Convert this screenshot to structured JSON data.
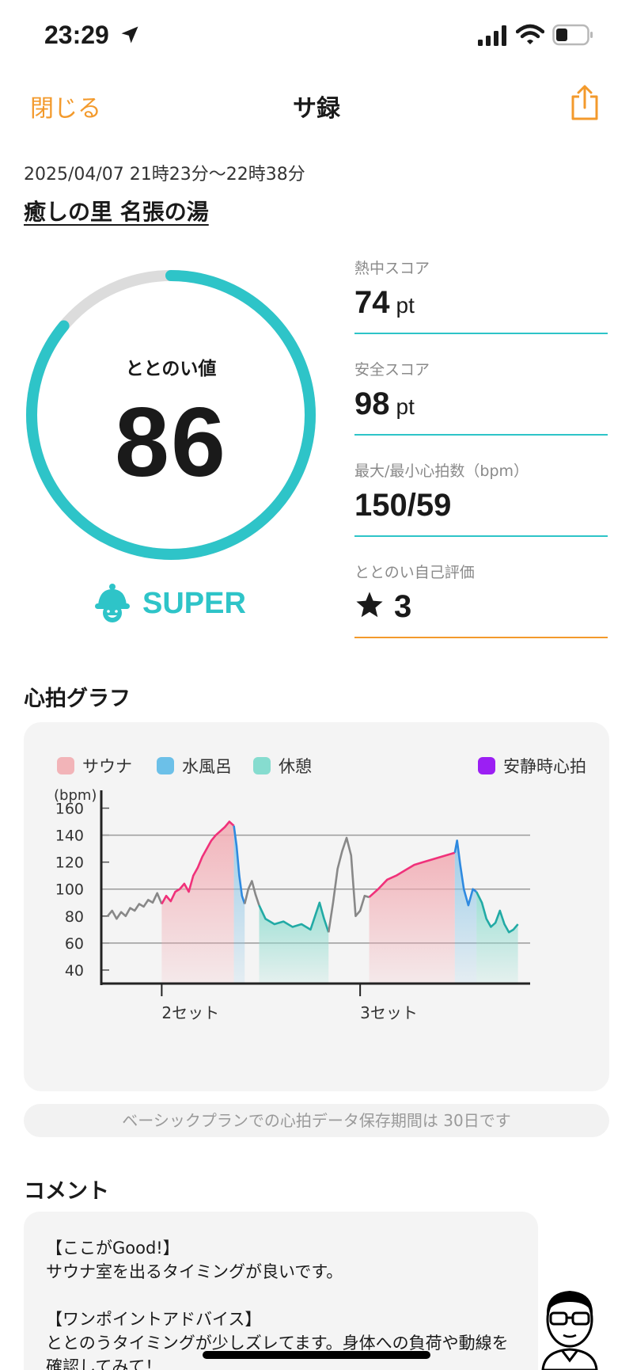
{
  "status": {
    "time": "23:29"
  },
  "nav": {
    "close_label": "閉じる",
    "title": "サ録"
  },
  "session": {
    "datetime": "2025/04/07 21時23分〜22時38分",
    "place": "癒しの里 名張の湯"
  },
  "gauge": {
    "label": "ととのい値",
    "value": "86",
    "fill_fraction": 0.86,
    "rank": "SUPER"
  },
  "scores": [
    {
      "label": "熱中スコア",
      "value": "74",
      "unit": "pt"
    },
    {
      "label": "安全スコア",
      "value": "98",
      "unit": "pt"
    },
    {
      "label": "最大/最小心拍数（bpm）",
      "value": "150/59",
      "unit": ""
    },
    {
      "label": "ととのい自己評価",
      "value": "3",
      "unit": ""
    }
  ],
  "colors": {
    "accent": "#2ec4c8",
    "orange": "#f39a2c",
    "sauna": "#f0317a",
    "water": "#2f8ae0",
    "rest": "#22aaa5",
    "resting_hr": "#9b1ff3"
  },
  "chart_section_title": "心拍グラフ",
  "legend": {
    "sauna": "サウナ",
    "water": "水風呂",
    "rest": "休憩",
    "resting_hr": "安静時心拍"
  },
  "chart_data": {
    "type": "line",
    "ylabel": "(bpm)",
    "ylim": [
      30,
      165
    ],
    "yticks": [
      "160",
      "140",
      "120",
      "100",
      "80",
      "60",
      "40"
    ],
    "x_markers": [
      {
        "x": 12,
        "label": "2セット"
      },
      {
        "x": 56,
        "label": "3セット"
      }
    ],
    "xlim": [
      0,
      93
    ],
    "segments": [
      {
        "phase": "other",
        "points": [
          [
            0,
            80
          ],
          [
            1,
            84
          ],
          [
            2,
            78
          ],
          [
            3,
            83
          ],
          [
            4,
            80
          ],
          [
            5,
            86
          ],
          [
            6,
            84
          ],
          [
            7,
            89
          ],
          [
            8,
            87
          ],
          [
            9,
            92
          ],
          [
            10,
            90
          ],
          [
            11,
            97
          ],
          [
            12,
            89
          ]
        ]
      },
      {
        "phase": "sauna",
        "points": [
          [
            12,
            89
          ],
          [
            13,
            95
          ],
          [
            14,
            91
          ],
          [
            15,
            98
          ],
          [
            16,
            100
          ],
          [
            17,
            104
          ],
          [
            18,
            98
          ],
          [
            19,
            110
          ],
          [
            20,
            116
          ],
          [
            21,
            124
          ],
          [
            22,
            130
          ],
          [
            23,
            136
          ],
          [
            24,
            140
          ],
          [
            25,
            143
          ],
          [
            26,
            146
          ],
          [
            27,
            150
          ],
          [
            28,
            147
          ]
        ]
      },
      {
        "phase": "water",
        "points": [
          [
            28,
            147
          ],
          [
            28.6,
            132
          ],
          [
            29.2,
            110
          ],
          [
            29.8,
            95
          ],
          [
            30.4,
            89
          ]
        ]
      },
      {
        "phase": "other",
        "points": [
          [
            30.4,
            89
          ],
          [
            31.2,
            100
          ],
          [
            32,
            106
          ],
          [
            32.8,
            96
          ],
          [
            33.6,
            88
          ]
        ]
      },
      {
        "phase": "rest",
        "points": [
          [
            33.6,
            88
          ],
          [
            35,
            78
          ],
          [
            37,
            74
          ],
          [
            39,
            76
          ],
          [
            41,
            72
          ],
          [
            43,
            74
          ],
          [
            45,
            70
          ],
          [
            46,
            80
          ],
          [
            47,
            90
          ],
          [
            48,
            78
          ],
          [
            49,
            68
          ]
        ]
      },
      {
        "phase": "other",
        "points": [
          [
            49,
            68
          ],
          [
            50,
            90
          ],
          [
            51,
            115
          ],
          [
            52,
            128
          ],
          [
            53,
            138
          ],
          [
            54,
            125
          ],
          [
            55,
            80
          ],
          [
            56,
            84
          ],
          [
            57,
            95
          ],
          [
            58,
            94
          ]
        ]
      },
      {
        "phase": "sauna",
        "points": [
          [
            58,
            94
          ],
          [
            60,
            100
          ],
          [
            62,
            107
          ],
          [
            64,
            110
          ],
          [
            66,
            114
          ],
          [
            68,
            118
          ],
          [
            70,
            120
          ],
          [
            72,
            122
          ],
          [
            74,
            124
          ],
          [
            76,
            126
          ],
          [
            77,
            127
          ]
        ]
      },
      {
        "phase": "water",
        "points": [
          [
            77,
            127
          ],
          [
            77.5,
            136
          ],
          [
            78.2,
            118
          ],
          [
            79,
            100
          ],
          [
            80,
            88
          ],
          [
            81,
            100
          ],
          [
            81.8,
            98
          ]
        ]
      },
      {
        "phase": "rest",
        "points": [
          [
            81.8,
            98
          ],
          [
            83,
            90
          ],
          [
            84,
            78
          ],
          [
            85,
            72
          ],
          [
            86,
            75
          ],
          [
            87,
            84
          ],
          [
            88,
            74
          ],
          [
            89,
            68
          ],
          [
            90,
            70
          ],
          [
            91,
            74
          ]
        ]
      }
    ],
    "phase_bands": [
      {
        "phase": "sauna",
        "x0": 12,
        "x1": 28
      },
      {
        "phase": "water",
        "x0": 28,
        "x1": 30.4
      },
      {
        "phase": "rest",
        "x0": 33.6,
        "x1": 49
      },
      {
        "phase": "sauna",
        "x0": 58,
        "x1": 77
      },
      {
        "phase": "water",
        "x0": 77,
        "x1": 81.8
      },
      {
        "phase": "rest",
        "x0": 81.8,
        "x1": 91
      }
    ]
  },
  "notice": "ベーシックプランでの心拍データ保存期間は 30日です",
  "comment_section_title": "コメント",
  "comment": {
    "good_heading": "【ここがGood!】",
    "good_text": "サウナ室を出るタイミングが良いです。",
    "advice_heading": "【ワンポイントアドバイス】",
    "advice_text_1": "ととのうタイミングが少しズレてます。身体への負荷や動線を",
    "advice_text_2": "確認してみて！"
  }
}
